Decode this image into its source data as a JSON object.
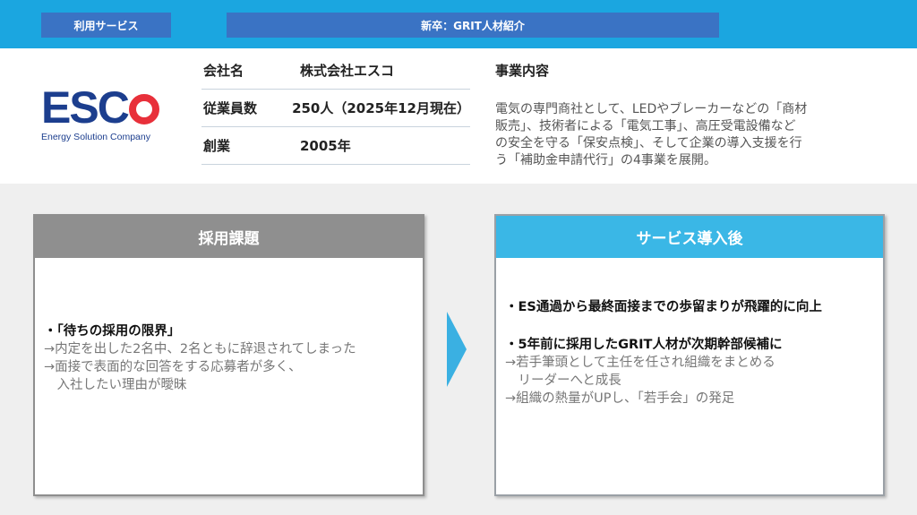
{
  "header": {
    "left_pill": "利用サービス",
    "center_pill": "新卒：GRIT人材紹介"
  },
  "logo": {
    "word": "ESCO",
    "tagline": "Energy Solution Company"
  },
  "company_info": [
    {
      "label": "会社名",
      "value": "株式会社エスコ"
    },
    {
      "label": "従業員数",
      "value": "250人（2025年12月現在）"
    },
    {
      "label": "創業",
      "value": "2005年"
    }
  ],
  "business": {
    "title": "事業内容",
    "lines": [
      "電気の専門商社として、LEDやブレーカーなどの「商材",
      "販売」、技術者による「電気工事」、高圧受電設備など",
      "の安全を守る「保安点検」、そして企業の導入支援を行",
      "う「補助金申請代行」の4事業を展開。"
    ]
  },
  "challenge": {
    "title": "採用課題",
    "lines": [
      "・「待ちの採用の限界」",
      "→内定を出した2名中、2名ともに辞退されてしまった",
      "→面接で表面的な回答をする応募者が多く、",
      "　入社したい理由が曖昧"
    ]
  },
  "after": {
    "title": "サービス導入後",
    "lines": [
      "・ES通過から最終面接までの歩留まりが飛躍的に向上",
      "・5年前に採用したGRIT人材が次期幹部候補に",
      "→若手筆頭として主任を任され組織をまとめる",
      "　リーダーへと成長",
      "→組織の熱量がUPし、「若手会」の発足"
    ]
  },
  "colors": {
    "top_bar": "#1ba6e0",
    "pill": "#3a73c4",
    "accent": "#3ab7e6",
    "gray_header": "#8f8f8f"
  }
}
